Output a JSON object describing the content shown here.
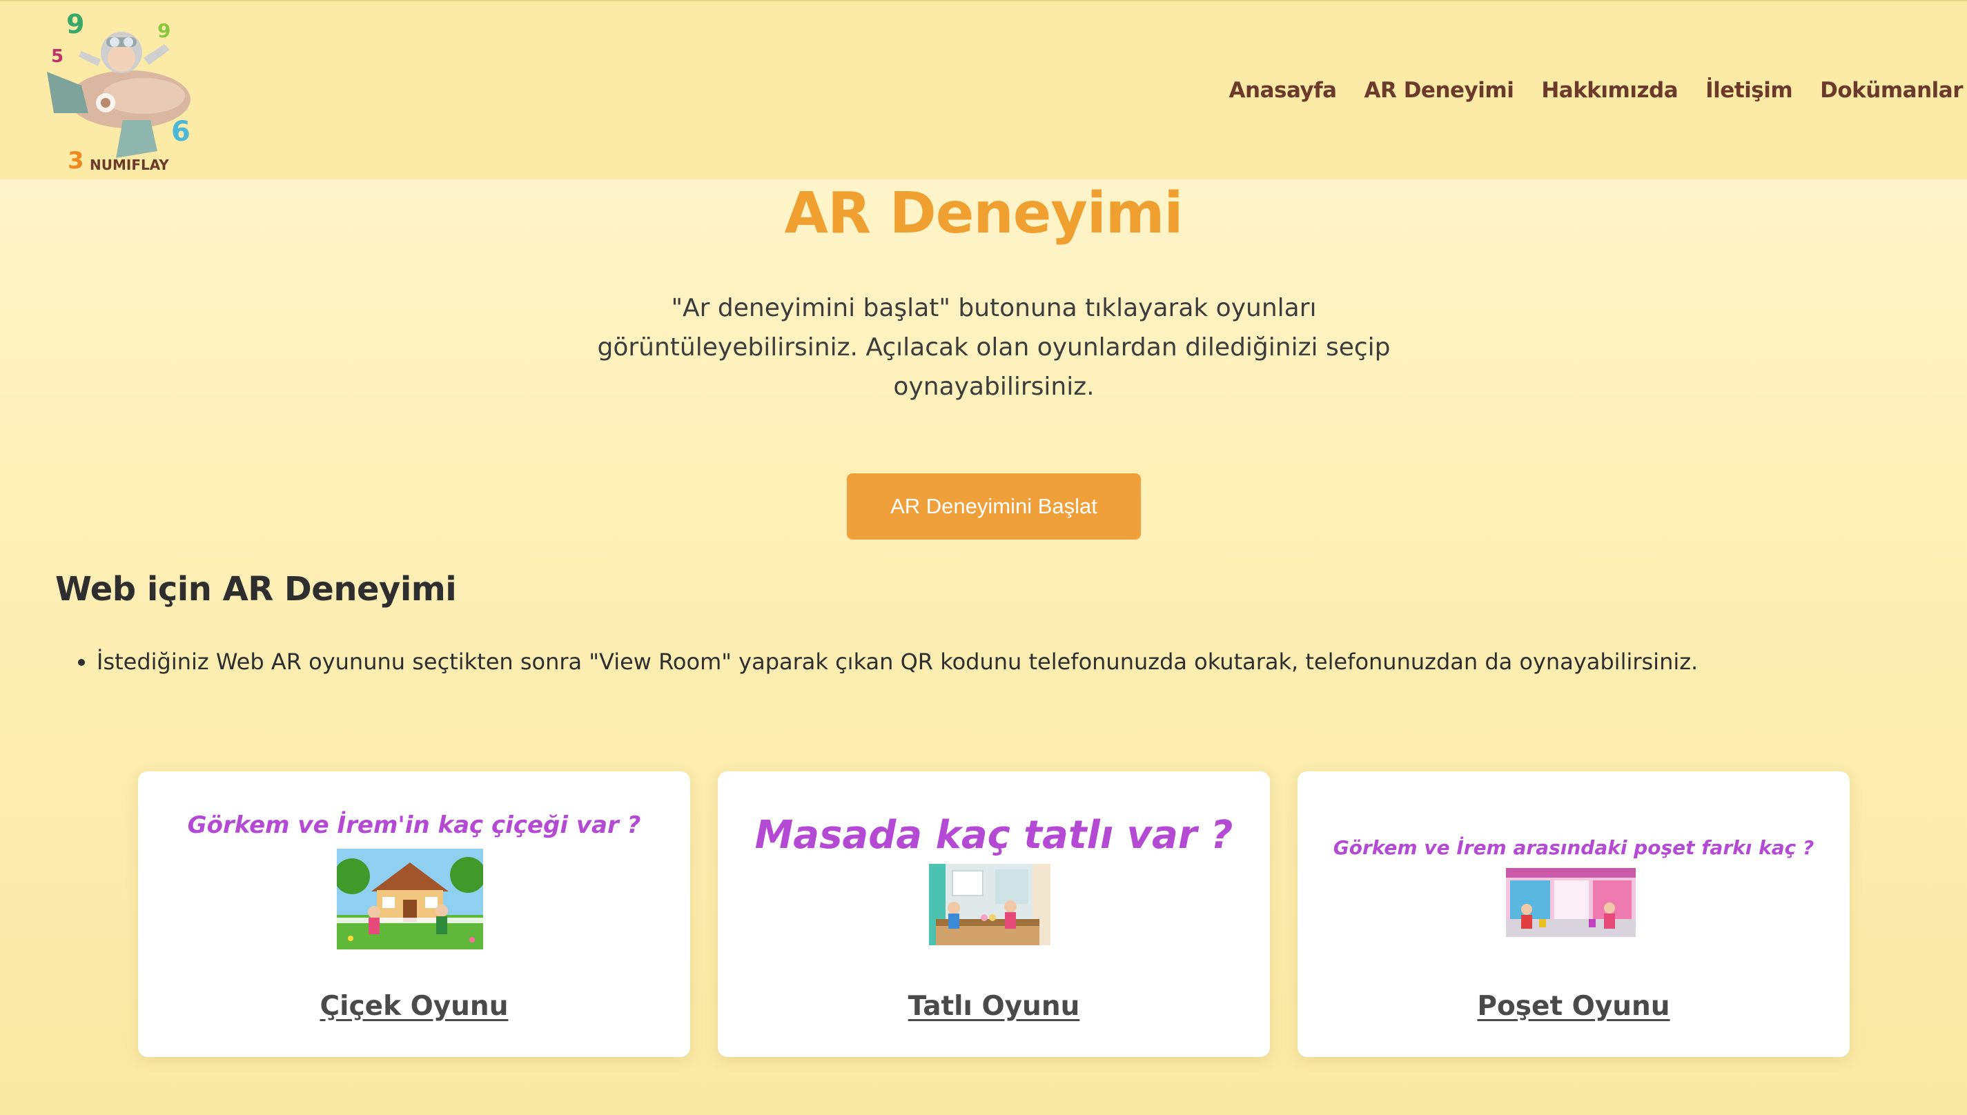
{
  "header": {
    "logo_text": "NUMIFLAY",
    "nav": [
      "Anasayfa",
      "AR Deneyimi",
      "Hakkımızda",
      "İletişim",
      "Dokümanlar"
    ]
  },
  "main": {
    "title": "AR Deneyimi",
    "intro_lines": [
      "\"Ar deneyimini başlat\" butonuna tıklayarak oyunları",
      "görüntüleyebilirsiniz. Açılacak olan oyunlardan dilediğinizi seçip",
      "oynayabilirsiniz."
    ],
    "cta_label": "AR Deneyimini Başlat",
    "web_section_title": "Web için AR Deneyimi",
    "web_bullet": "İstediğiniz Web AR oyununu seçtikten sonra \"View Room\" yaparak çıkan QR kodunu telefonunuzda okutarak, telefonunuzdan da oynayabilirsiniz."
  },
  "cards": [
    {
      "caption": "Görkem ve İrem'in kaç çiçeği var ?",
      "link": "Çiçek Oyunu"
    },
    {
      "caption": "Masada kaç tatlı var ?",
      "link": "Tatlı Oyunu"
    },
    {
      "caption": "Görkem ve İrem arasındaki poşet farkı kaç ?",
      "link": "Poşet Oyunu"
    }
  ],
  "colors": {
    "header_bg": "#fbeba6",
    "accent": "#f0a030",
    "nav_text": "#6b3a2a",
    "caption_purple": "#b44ad4"
  }
}
